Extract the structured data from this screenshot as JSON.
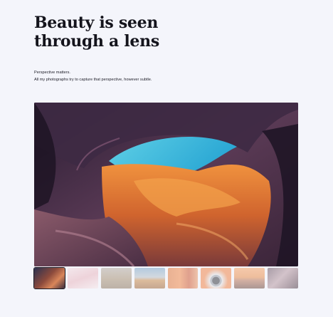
{
  "page": {
    "title": "Beauty is seen\nthrough a lens",
    "subtitle_lines": [
      "Perspective matters.",
      "All my photographs try to capture that perspective, however subtle."
    ]
  },
  "hero": {
    "icon": "canyon-photo"
  },
  "gallery": {
    "active_index": 0,
    "thumbnails": [
      {
        "icon": "canyon-thumbnail"
      },
      {
        "icon": "pink-fabric-thumbnail"
      },
      {
        "icon": "sand-texture-thumbnail"
      },
      {
        "icon": "desert-thumbnail"
      },
      {
        "icon": "orange-corridor-thumbnail"
      },
      {
        "icon": "camera-lens-thumbnail"
      },
      {
        "icon": "sunset-thumbnail"
      },
      {
        "icon": "rock-thumbnail"
      }
    ]
  }
}
